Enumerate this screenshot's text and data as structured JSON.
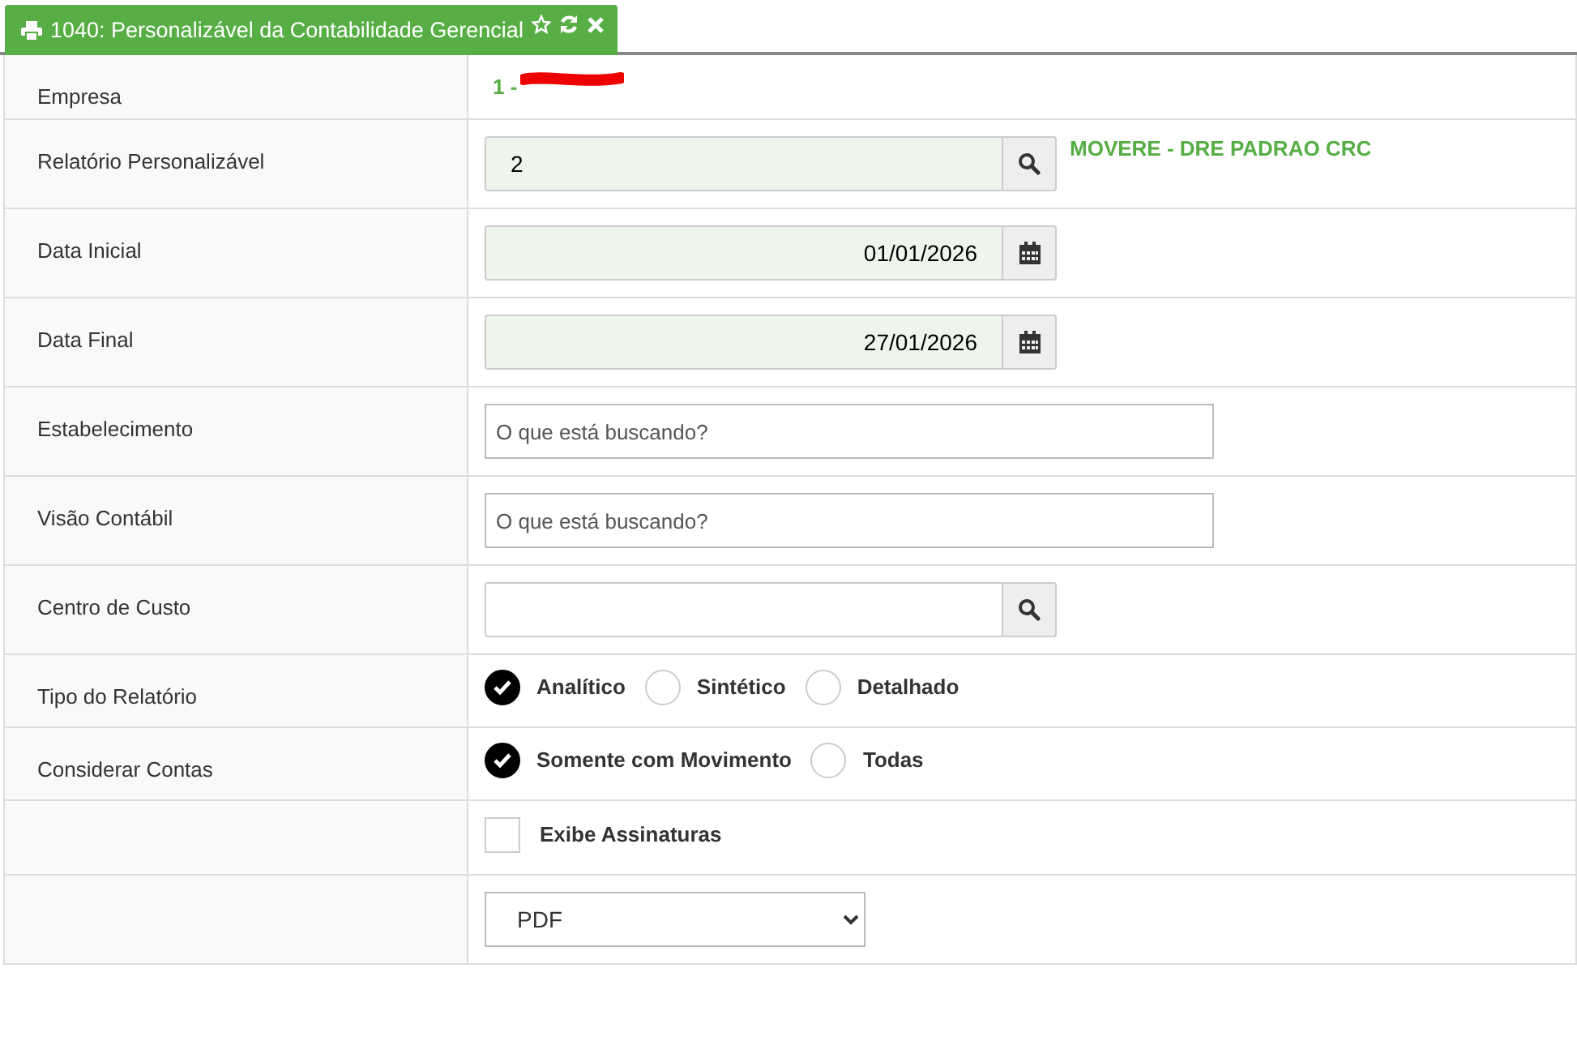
{
  "tab": {
    "title": "1040: Personalizável da Contabilidade Gerencial",
    "favorite": false
  },
  "rows": [
    {
      "kind": "company",
      "label": "Empresa",
      "value": "1 -",
      "redacted": true
    },
    {
      "kind": "lookup",
      "label": "Relatório Personalizável",
      "value": "2",
      "description": "MOVERE - DRE PADRAO CRC"
    },
    {
      "kind": "date",
      "label": "Data Inicial",
      "value": "01/01/2026"
    },
    {
      "kind": "date",
      "label": "Data Final",
      "value": "27/01/2026"
    },
    {
      "kind": "search",
      "label": "Estabelecimento",
      "placeholder": "O que está buscando?"
    },
    {
      "kind": "search",
      "label": "Visão Contábil",
      "placeholder": "O que está buscando?"
    },
    {
      "kind": "lookup",
      "label": "Centro de Custo",
      "value": ""
    },
    {
      "kind": "radio",
      "label": "Tipo do Relatório",
      "options": [
        {
          "label": "Analítico",
          "selected": true
        },
        {
          "label": "Sintético",
          "selected": false
        },
        {
          "label": "Detalhado",
          "selected": false
        }
      ]
    },
    {
      "kind": "radio",
      "label": "Considerar Contas",
      "options": [
        {
          "label": "Somente com Movimento",
          "selected": true
        },
        {
          "label": "Todas",
          "selected": false
        }
      ]
    },
    {
      "kind": "checkbox",
      "label": "",
      "text": "Exibe Assinaturas",
      "checked": false
    },
    {
      "kind": "select",
      "label": "",
      "value": "PDF"
    }
  ]
}
